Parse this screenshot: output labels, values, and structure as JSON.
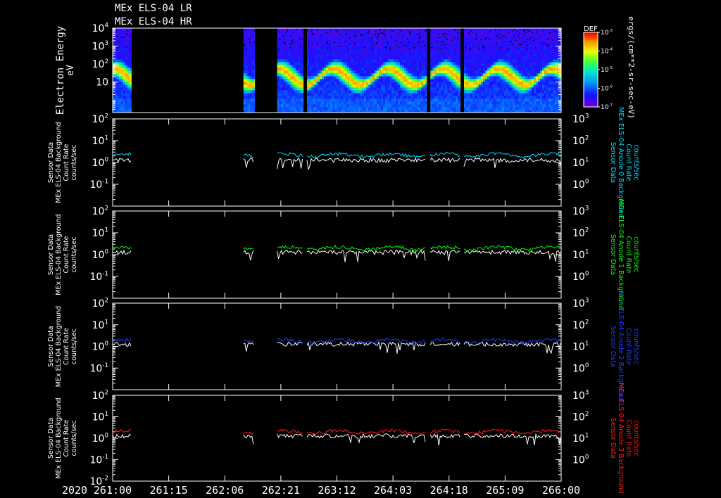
{
  "header": {
    "title_line1": "MEx ELS-04 LR",
    "title_line2": "MEx ELS-04 HR"
  },
  "spectrogram": {
    "ylabel_1": "Electron Energy",
    "ylabel_2": "eV",
    "ticks": [
      "10",
      "10",
      "10",
      "10"
    ],
    "tick_exps": [
      "4",
      "3",
      "2",
      ""
    ],
    "colorbar": {
      "title": "DEF",
      "unit_label": "ergs/(cm**2-sr-sec-eV)",
      "ticks": [
        "10",
        "10",
        "10",
        "10",
        "10"
      ],
      "tick_exps": [
        "-3",
        "-4",
        "-5",
        "-6",
        "-7"
      ],
      "colors": [
        "#ff0000",
        "#ff8c00",
        "#ffff00",
        "#00ff00",
        "#00ffff",
        "#0060ff",
        "#0000ff",
        "#7f00ff"
      ]
    }
  },
  "left_axis_ticks": [
    {
      "base": "10",
      "exp": "2"
    },
    {
      "base": "10",
      "exp": "1"
    },
    {
      "base": "10",
      "exp": "0"
    },
    {
      "base": "10",
      "exp": "-1"
    }
  ],
  "bottom_left_tick": {
    "base": "10",
    "exp": "-2"
  },
  "right_axis_ticks": [
    {
      "base": "10",
      "exp": "3"
    },
    {
      "base": "10",
      "exp": "2"
    },
    {
      "base": "10",
      "exp": "1"
    },
    {
      "base": "10",
      "exp": "0"
    }
  ],
  "count_panels": [
    {
      "left_label": [
        "Sensor Data",
        "MEx ELS-04 Background",
        "Count Rate",
        "counts/sec"
      ],
      "right_label": [
        "Sensor Data",
        "MEx ELS-04 Anode 0 Background",
        "Count Rate",
        "counts/sec"
      ],
      "color": "#00d8ff"
    },
    {
      "left_label": [
        "Sensor Data",
        "MEx ELS-04 Background",
        "Count Rate",
        "counts/sec"
      ],
      "right_label": [
        "Sensor Data",
        "MEx ELS-04 Anode 1 Background",
        "Count Rate",
        "counts/sec"
      ],
      "color": "#00ff00"
    },
    {
      "left_label": [
        "Sensor Data",
        "MEx ELS-04 Background",
        "Count Rate",
        "counts/sec"
      ],
      "right_label": [
        "Sensor Data",
        "MEx ELS-04 Anode 2 Background",
        "Count Rate",
        "counts/sec"
      ],
      "color": "#1e3cff"
    },
    {
      "left_label": [
        "Sensor Data",
        "MEx ELS-04 Background",
        "Count Rate",
        "counts/sec"
      ],
      "right_label": [
        "Sensor Data",
        "MEx ELS-04 Anode 3 Background",
        "Count Rate",
        "counts/sec"
      ],
      "color": "#ff1a1a"
    }
  ],
  "time_axis": {
    "year": "2020",
    "labels": [
      "261:00",
      "261:15",
      "262:06",
      "262:21",
      "263:12",
      "264:03",
      "264:18",
      "265:09",
      "266:00"
    ]
  },
  "chart_data": {
    "type": "heatmap",
    "x_range": [
      "261:00",
      "266:00"
    ],
    "ylim_spectrogram": [
      0.2,
      10000
    ],
    "ylim_left": [
      0.01,
      100
    ],
    "ylim_right": [
      0.1,
      1000
    ],
    "data_intervals": [
      [
        "261:00",
        "261:05"
      ],
      [
        "262:11",
        "262:14"
      ],
      [
        "262:20",
        "263:03"
      ],
      [
        "263:04",
        "264:12"
      ],
      [
        "264:13",
        "264:21"
      ],
      [
        "264:22",
        "266:00"
      ]
    ],
    "series_levels": {
      "colored_right_axis_counts_per_sec": [
        22,
        20,
        18,
        20
      ],
      "white_counts_per_sec": 1.3
    }
  }
}
